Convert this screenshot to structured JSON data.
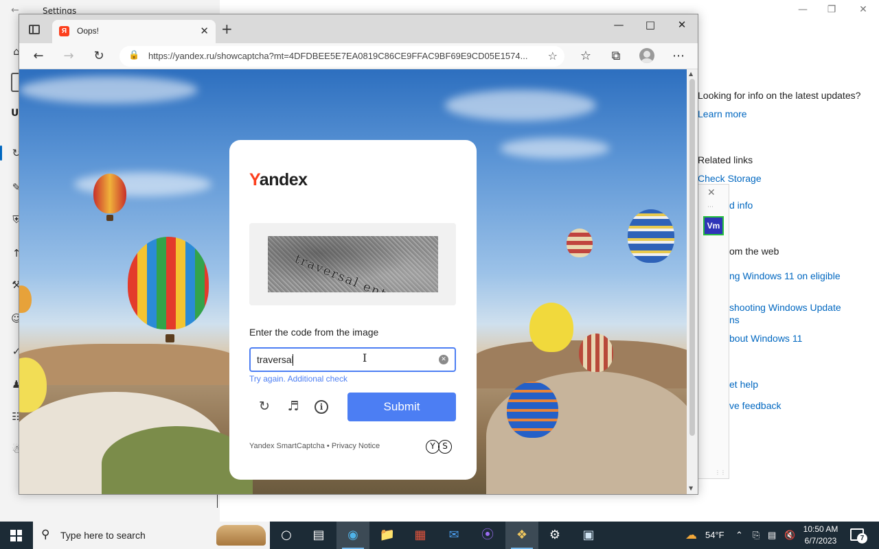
{
  "settings": {
    "title": "Settings",
    "nav_partial_label": "U",
    "related": {
      "question": "Looking for info on the latest updates?",
      "learn_more": "Learn more",
      "related_links_heading": "Related links",
      "check_storage": "Check Storage",
      "os_build_info": "d info",
      "from_web_heading": "om the web",
      "upgrading_link": "ng Windows 11 on eligible",
      "troubleshooting_line1": "shooting Windows Update",
      "troubleshooting_line2": "ns",
      "about_link": "bout Windows 11",
      "get_help": "et help",
      "give_feedback": "ve feedback"
    }
  },
  "vm_panel": {
    "badge": "Vm"
  },
  "browser": {
    "tab_title": "Oops!",
    "url": "https://yandex.ru/showcaptcha?mt=4DFDBEE5E7EA0819C86CE9FFAC9BF69E9CD05E1574..."
  },
  "captcha": {
    "logo_first": "Y",
    "logo_rest": "andex",
    "captcha_image_text": "traversal entangle",
    "prompt": "Enter the code from the image",
    "input_value": "traversal ",
    "error_text": "Try again. Additional check",
    "submit_label": "Submit",
    "footer": "Yandex SmartCaptcha • Privacy Notice",
    "brand_marks": [
      "Y",
      "S"
    ]
  },
  "taskbar": {
    "search_placeholder": "Type here to search",
    "weather": "54°F",
    "time": "10:50 AM",
    "date": "6/7/2023",
    "notification_count": "7"
  },
  "colors": {
    "accent": "#4c7ef3",
    "yandex_red": "#fc3f1d",
    "link": "#0067c0",
    "taskbar": "#1c2b36"
  }
}
